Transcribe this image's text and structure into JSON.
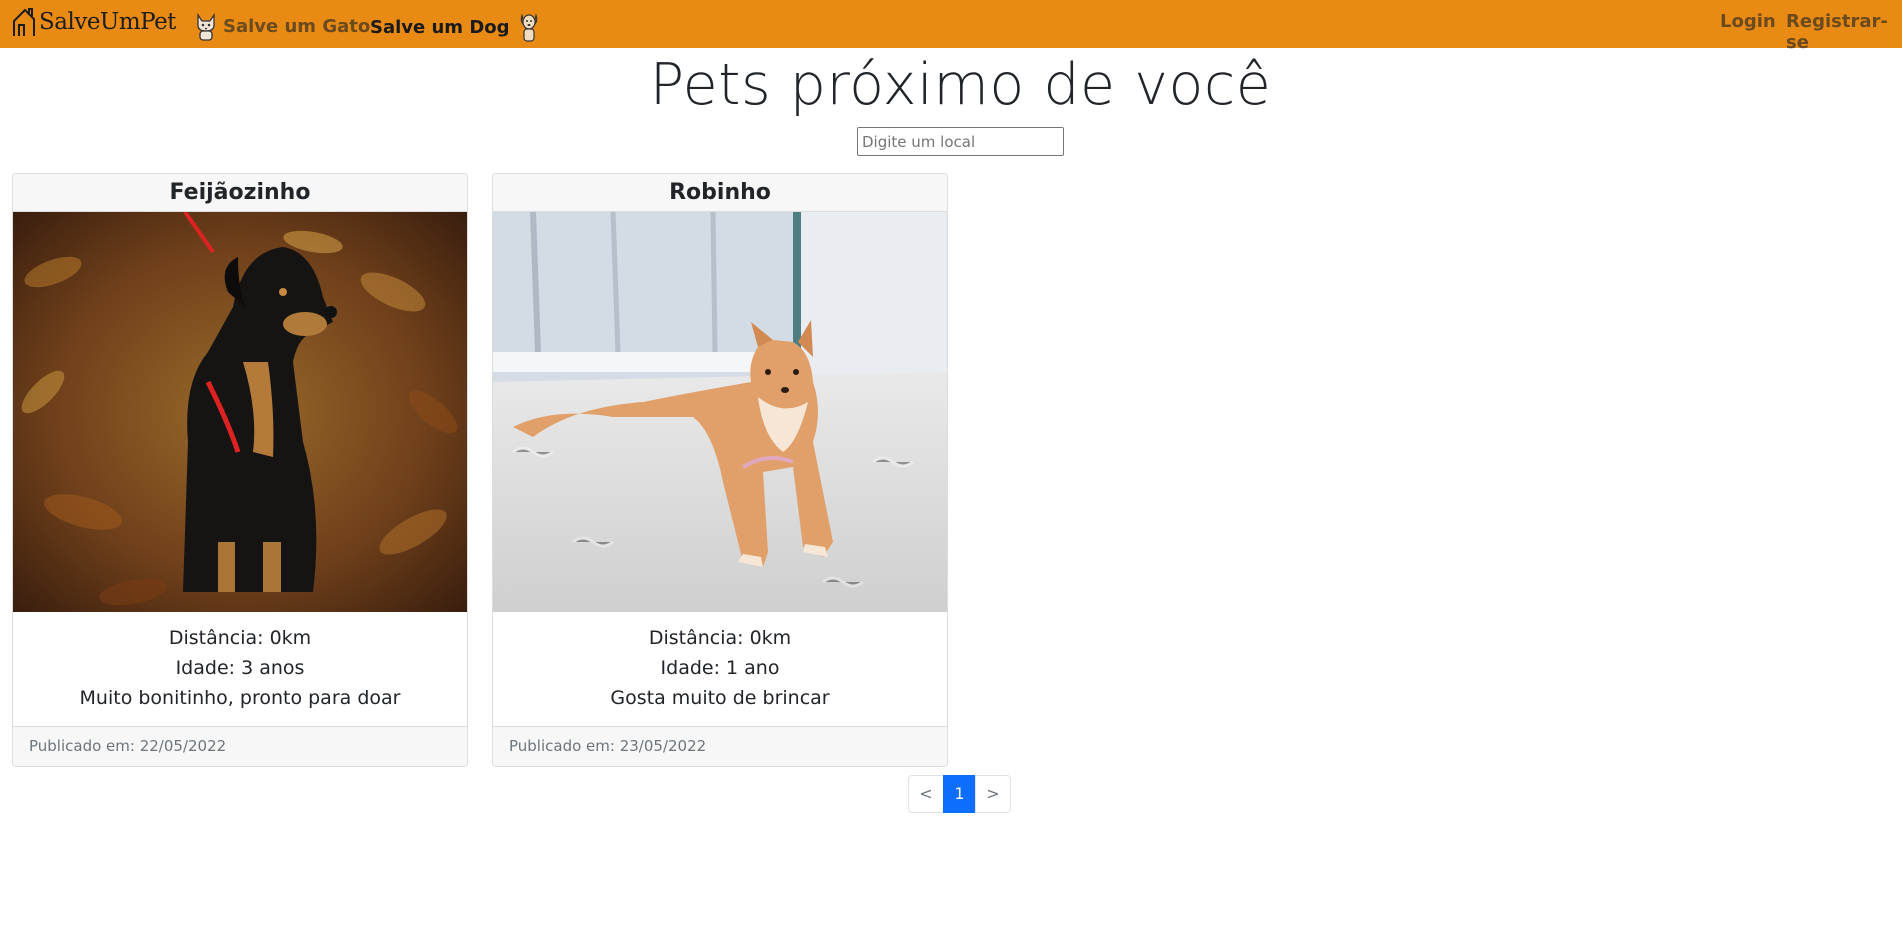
{
  "navbar": {
    "brand": "SalveUmPet",
    "brand_icon": "house-icon",
    "cat_link": "Salve um Gato",
    "cat_icon": "cat-icon",
    "dog_link": "Salve um Dog",
    "dog_icon": "dog-icon",
    "login": "Login",
    "register": "Registrar-se",
    "background_color": "#e98a14"
  },
  "main": {
    "title": "Pets próximo de você",
    "search_placeholder": "Digite um local",
    "search_value": ""
  },
  "pets": [
    {
      "name": "Feijãozinho",
      "image_desc": "dog-photo",
      "distance": "Distância: 0km",
      "age": "Idade: 3 anos",
      "description": "Muito bonitinho, pronto para doar",
      "published": "Publicado em: 22/05/2022"
    },
    {
      "name": "Robinho",
      "image_desc": "dog-photo",
      "distance": "Distância: 0km",
      "age": "Idade: 1 ano",
      "description": "Gosta muito de brincar",
      "published": "Publicado em: 23/05/2022"
    }
  ],
  "pagination": {
    "prev": "<",
    "current": "1",
    "next": ">",
    "active_color": "#0d6efd"
  }
}
